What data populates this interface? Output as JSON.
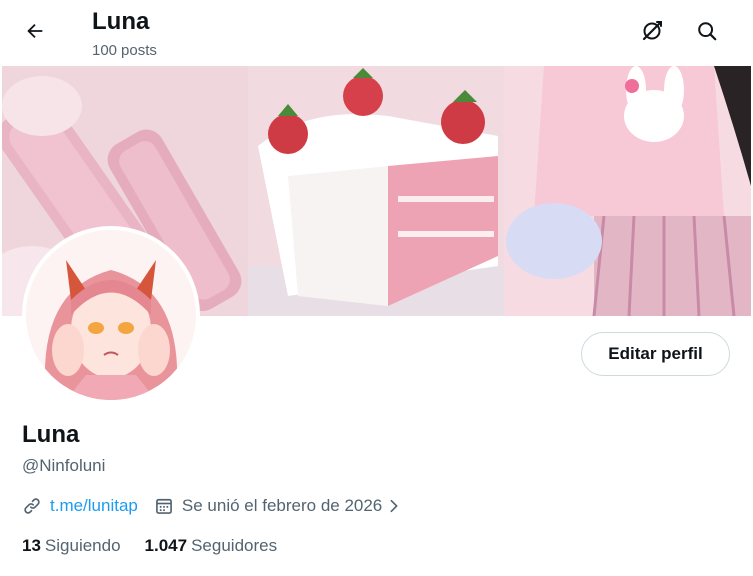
{
  "header": {
    "name": "Luna",
    "posts_count": "100",
    "posts_label": "posts"
  },
  "profile": {
    "display_name": "Luna",
    "handle": "@Ninfoluni",
    "link_text": "t.me/lunitap",
    "joined_text": "Se unió el febrero de 2026",
    "edit_button_label": "Editar perfil"
  },
  "stats": {
    "following_count": "13",
    "following_label": "Siguiendo",
    "followers_count": "1.047",
    "followers_label": "Seguidores"
  },
  "icons": {
    "back": "arrow-left-icon",
    "grok": "grok-icon",
    "search": "search-icon",
    "link": "link-icon",
    "calendar": "calendar-icon",
    "chevron": "chevron-right-icon"
  },
  "colors": {
    "accent_link": "#1d9bf0",
    "text_primary": "#0f1419",
    "text_secondary": "#536471",
    "border": "#cfd9de"
  }
}
